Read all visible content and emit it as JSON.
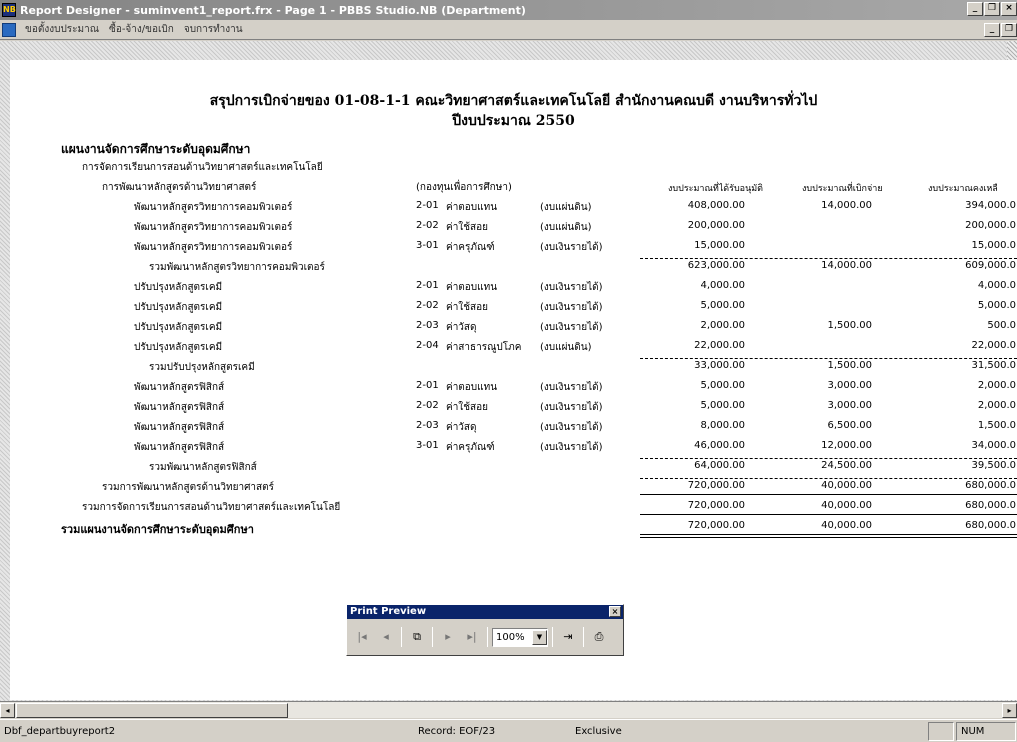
{
  "window": {
    "title": "Report Designer - suminvent1_report.frx - Page 1 - PBBS Studio.NB (Department)",
    "app_icon": "NB"
  },
  "menu": [
    "ขอตั้งงบประมาณ",
    "ซื้อ-จ้าง/ขอเบิก",
    "จบการทำงาน"
  ],
  "report": {
    "title_line1": "สรุปการเบิกจ่ายของ 01-08-1-1 คณะวิทยาศาสตร์และเทคโนโลยี สำนักงานคณบดี งานบริหารทั่วไป",
    "title_line2": "ปีงบประมาณ 2550",
    "plan": "แผนงานจัดการศึกษาระดับอุดมศึกษา",
    "program": "การจัดการเรียนการสอนด้านวิทยาศาสตร์และเทคโนโลยี",
    "project": "การพัฒนาหลักสูตรด้านวิทยาศาสตร์",
    "fund": "(กองทุนเพื่อการศึกษา)",
    "col_headers": [
      "งบประมาณที่ได้รับอนุมัติ",
      "งบประมาณที่เบิกจ่าย",
      "งบประมาณคงเหลื"
    ],
    "rows": [
      {
        "name": "พัฒนาหลักสูตรวิทยาการคอมพิวเตอร์",
        "code": "2-01",
        "type": "ค่าตอบแทน",
        "src": "(งบแผ่นดิน)",
        "approved": "408,000.00",
        "spent": "14,000.00",
        "remain": "394,000.0"
      },
      {
        "name": "พัฒนาหลักสูตรวิทยาการคอมพิวเตอร์",
        "code": "2-02",
        "type": "ค่าใช้สอย",
        "src": "(งบแผ่นดิน)",
        "approved": "200,000.00",
        "spent": "",
        "remain": "200,000.0"
      },
      {
        "name": "พัฒนาหลักสูตรวิทยาการคอมพิวเตอร์",
        "code": "3-01",
        "type": "ค่าครุภัณฑ์",
        "src": "(งบเงินรายได้)",
        "approved": "15,000.00",
        "spent": "",
        "remain": "15,000.0"
      },
      {
        "name": "ปรับปรุงหลักสูตรเคมี",
        "code": "2-01",
        "type": "ค่าตอบแทน",
        "src": "(งบเงินรายได้)",
        "approved": "4,000.00",
        "spent": "",
        "remain": "4,000.0"
      },
      {
        "name": "ปรับปรุงหลักสูตรเคมี",
        "code": "2-02",
        "type": "ค่าใช้สอย",
        "src": "(งบเงินรายได้)",
        "approved": "5,000.00",
        "spent": "",
        "remain": "5,000.0"
      },
      {
        "name": "ปรับปรุงหลักสูตรเคมี",
        "code": "2-03",
        "type": "ค่าวัสดุ",
        "src": "(งบเงินรายได้)",
        "approved": "2,000.00",
        "spent": "1,500.00",
        "remain": "500.0"
      },
      {
        "name": "ปรับปรุงหลักสูตรเคมี",
        "code": "2-04",
        "type": "ค่าสาธารณูปโภค",
        "src": "(งบแผ่นดิน)",
        "approved": "22,000.00",
        "spent": "",
        "remain": "22,000.0"
      },
      {
        "name": "พัฒนาหลักสูตรฟิสิกส์",
        "code": "2-01",
        "type": "ค่าตอบแทน",
        "src": "(งบเงินรายได้)",
        "approved": "5,000.00",
        "spent": "3,000.00",
        "remain": "2,000.0"
      },
      {
        "name": "พัฒนาหลักสูตรฟิสิกส์",
        "code": "2-02",
        "type": "ค่าใช้สอย",
        "src": "(งบเงินรายได้)",
        "approved": "5,000.00",
        "spent": "3,000.00",
        "remain": "2,000.0"
      },
      {
        "name": "พัฒนาหลักสูตรฟิสิกส์",
        "code": "2-03",
        "type": "ค่าวัสดุ",
        "src": "(งบเงินรายได้)",
        "approved": "8,000.00",
        "spent": "6,500.00",
        "remain": "1,500.0"
      },
      {
        "name": "พัฒนาหลักสูตรฟิสิกส์",
        "code": "3-01",
        "type": "ค่าครุภัณฑ์",
        "src": "(งบเงินรายได้)",
        "approved": "46,000.00",
        "spent": "12,000.00",
        "remain": "34,000.0"
      }
    ],
    "subtotals": [
      {
        "label": "รวมพัฒนาหลักสูตรวิทยาการคอมพิวเตอร์",
        "approved": "623,000.00",
        "spent": "14,000.00",
        "remain": "609,000.0"
      },
      {
        "label": "รวมปรับปรุงหลักสูตรเคมี",
        "approved": "33,000.00",
        "spent": "1,500.00",
        "remain": "31,500.0"
      },
      {
        "label": "รวมพัฒนาหลักสูตรฟิสิกส์",
        "approved": "64,000.00",
        "spent": "24,500.00",
        "remain": "39,500.0"
      },
      {
        "label": "รวมการพัฒนาหลักสูตรด้านวิทยาศาสตร์",
        "approved": "720,000.00",
        "spent": "40,000.00",
        "remain": "680,000.0"
      },
      {
        "label": "รวมการจัดการเรียนการสอนด้านวิทยาศาสตร์และเทคโนโลยี",
        "approved": "720,000.00",
        "spent": "40,000.00",
        "remain": "680,000.0"
      },
      {
        "label": "รวมแผนงานจัดการศึกษาระดับอุดมศึกษา",
        "approved": "720,000.00",
        "spent": "40,000.00",
        "remain": "680,000.0"
      }
    ]
  },
  "print_preview": {
    "title": "Print Preview",
    "zoom": "100%",
    "icons": [
      "first-page-icon",
      "prev-page-icon",
      "goto-page-icon",
      "next-page-icon",
      "last-page-icon",
      "exit-icon",
      "printer-icon"
    ]
  },
  "status": {
    "table": "Dbf_departbuyreport2",
    "record": "Record: EOF/23",
    "mode": "Exclusive",
    "num": "NUM"
  }
}
